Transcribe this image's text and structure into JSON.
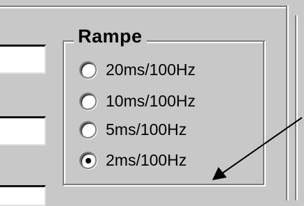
{
  "group": {
    "title": "Rampe"
  },
  "options": [
    {
      "label": "20ms/100Hz",
      "selected": false
    },
    {
      "label": "10ms/100Hz",
      "selected": false
    },
    {
      "label": "5ms/100Hz",
      "selected": false
    },
    {
      "label": "2ms/100Hz",
      "selected": true
    }
  ],
  "colors": {
    "dialog_background": "#c8c8c8",
    "arrow": "#000000"
  }
}
